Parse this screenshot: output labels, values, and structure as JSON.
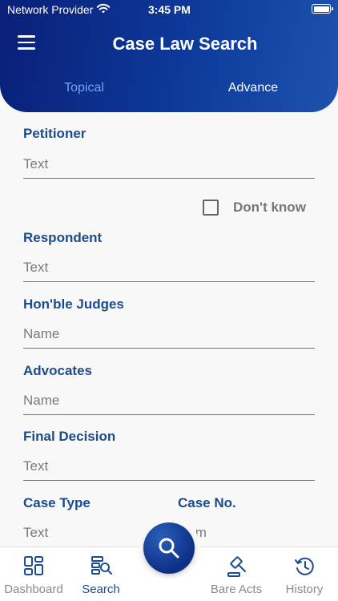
{
  "status_bar": {
    "carrier": "Network Provider",
    "time": "3:45 PM"
  },
  "header": {
    "title": "Case Law Search",
    "menu_icon": "hamburger-menu-icon"
  },
  "tabs": [
    {
      "label": "Topical",
      "active": true
    },
    {
      "label": "Advance",
      "active": false
    }
  ],
  "form": {
    "petitioner": {
      "label": "Petitioner",
      "placeholder": "Text"
    },
    "dont_know": {
      "label": "Don't know",
      "checked": false
    },
    "respondent": {
      "label": "Respondent",
      "placeholder": "Text"
    },
    "judges": {
      "label": "Hon'ble Judges",
      "placeholder": "Name"
    },
    "advocates": {
      "label": "Advocates",
      "placeholder": "Name"
    },
    "final_decision": {
      "label": "Final Decision",
      "placeholder": "Text"
    },
    "case_type": {
      "label": "Case Type",
      "placeholder": "Text"
    },
    "case_no": {
      "label": "Case No.",
      "placeholder": "Num"
    }
  },
  "bottom_nav": [
    {
      "label": "Dashboard",
      "icon": "dashboard-icon",
      "active": false
    },
    {
      "label": "Search",
      "icon": "search-list-icon",
      "active": true
    },
    {
      "label": "Bare Acts",
      "icon": "gavel-icon",
      "active": false
    },
    {
      "label": "History",
      "icon": "history-icon",
      "active": false
    }
  ],
  "fab_icon": "search-icon",
  "colors": {
    "primary": "#0d3a9b",
    "label": "#1c4b8c",
    "tab_active": "#6ea6f0",
    "nav_active": "#1a4b93"
  }
}
